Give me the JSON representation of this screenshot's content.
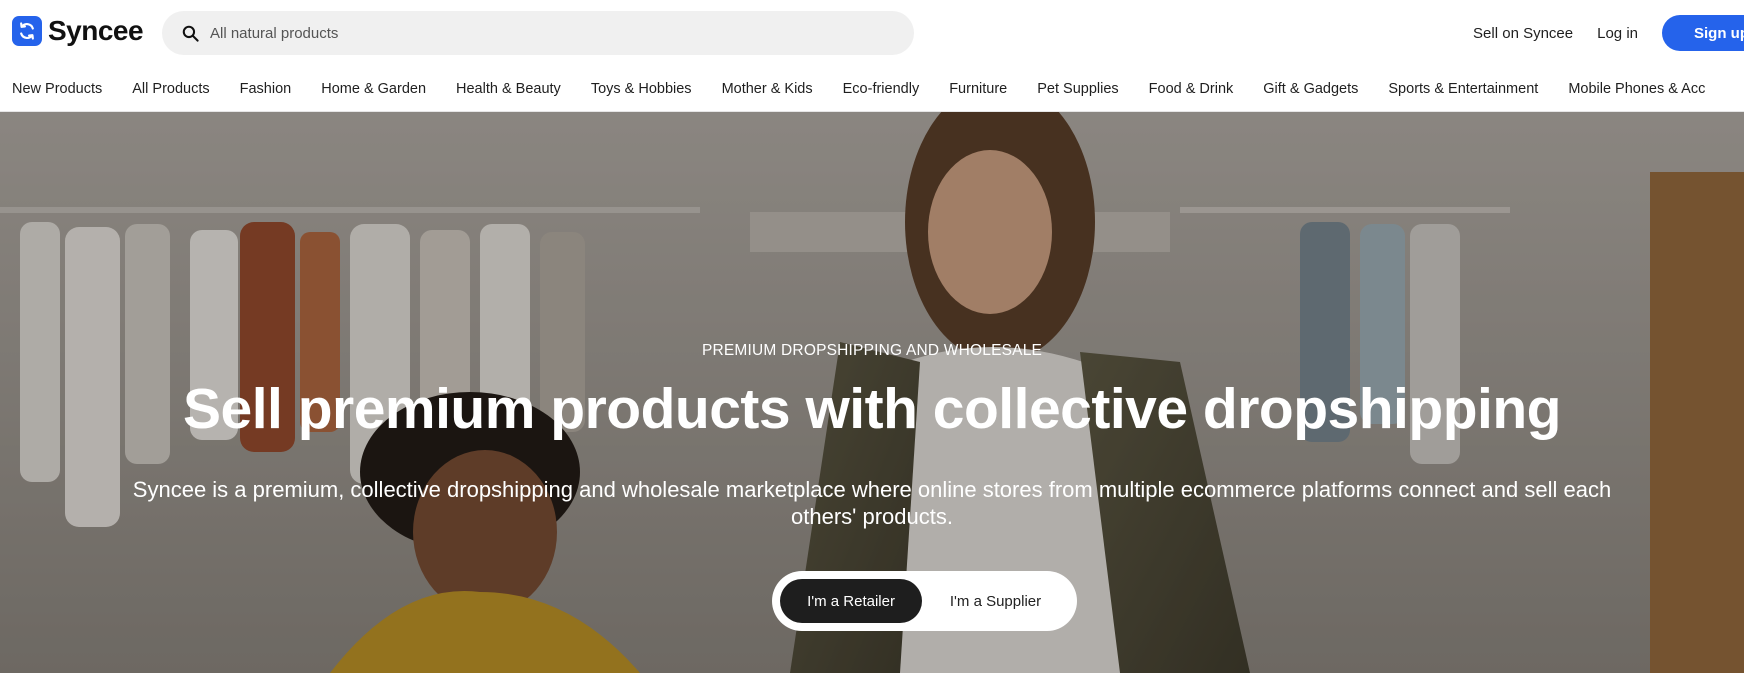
{
  "brand": {
    "name": "Syncee",
    "accent_color": "#2563eb",
    "logo_icon": "sync-arrows-icon"
  },
  "search": {
    "placeholder": "All natural products",
    "icon": "search-icon"
  },
  "header": {
    "sell_link": "Sell on Syncee",
    "login_link": "Log in",
    "signup_button": "Sign up"
  },
  "categories": [
    "New Products",
    "All Products",
    "Fashion",
    "Home & Garden",
    "Health & Beauty",
    "Toys & Hobbies",
    "Mother & Kids",
    "Eco-friendly",
    "Furniture",
    "Pet Supplies",
    "Food & Drink",
    "Gift & Gadgets",
    "Sports & Entertainment",
    "Mobile Phones & Acc"
  ],
  "hero": {
    "eyebrow": "PREMIUM DROPSHIPPING AND WHOLESALE",
    "headline": "Sell premium products with collective dropshipping",
    "subtitle": "Syncee is a premium, collective dropshipping and wholesale marketplace where online stores from multiple ecommerce platforms connect and sell each others' products.",
    "toggle": {
      "retailer": "I'm a Retailer",
      "supplier": "I'm a Supplier",
      "selected": "retailer"
    }
  }
}
